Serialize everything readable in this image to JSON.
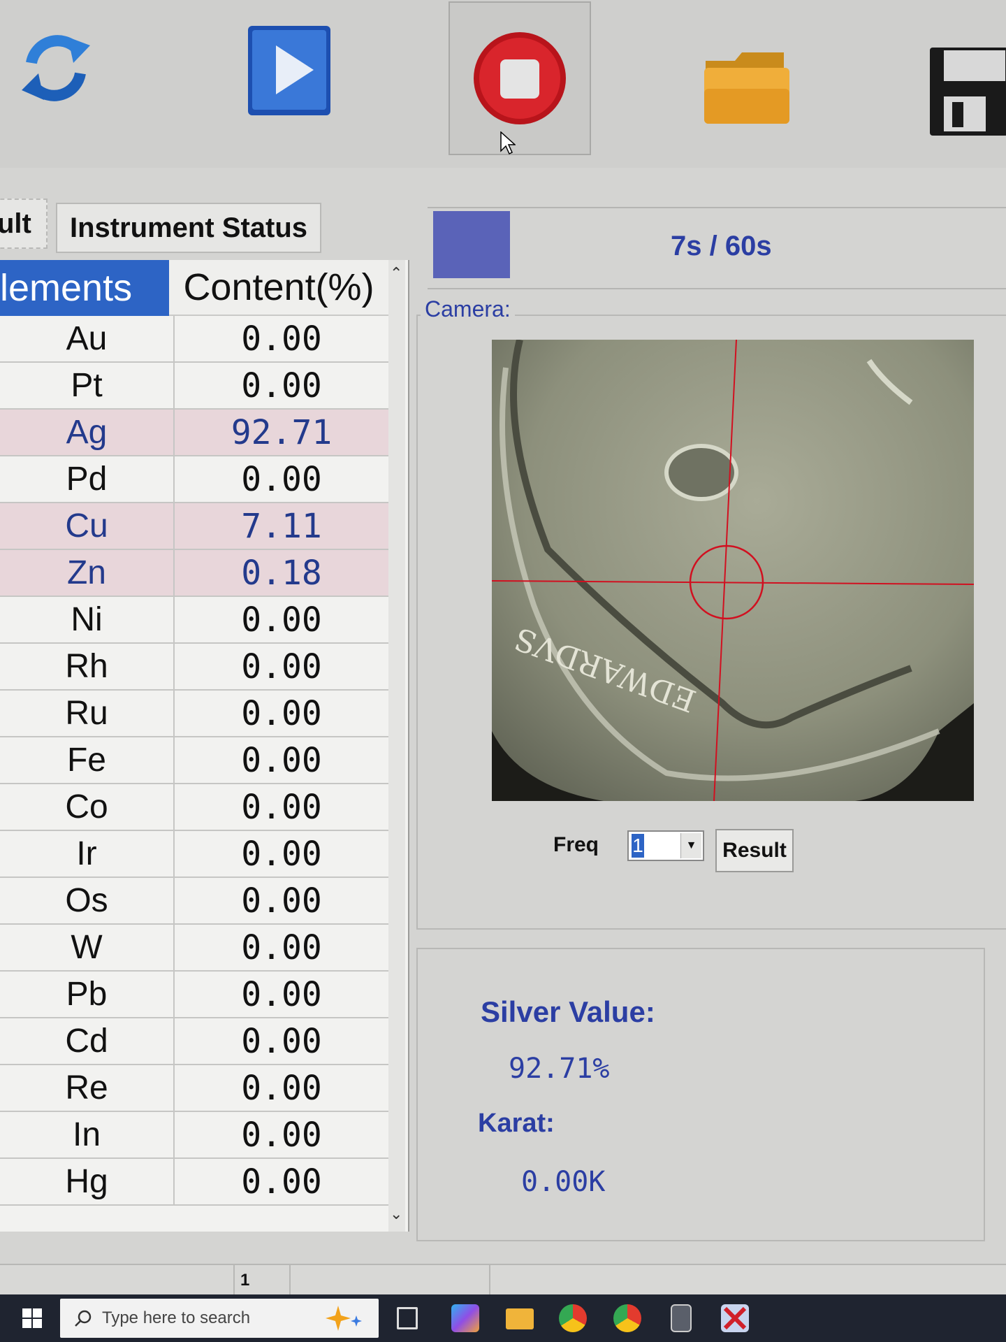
{
  "toolbar": {
    "buttons": [
      "refresh-icon",
      "play-icon",
      "stop-icon",
      "folder-icon",
      "save-icon"
    ]
  },
  "tabs": {
    "result": "ult",
    "status": "Instrument Status"
  },
  "table": {
    "headers": {
      "elements": "lements",
      "content": "Content(%)"
    },
    "rows": [
      {
        "el": "Au",
        "val": "0.00"
      },
      {
        "el": "Pt",
        "val": "0.00"
      },
      {
        "el": "Ag",
        "val": "92.71"
      },
      {
        "el": "Pd",
        "val": "0.00"
      },
      {
        "el": "Cu",
        "val": "7.11"
      },
      {
        "el": "Zn",
        "val": "0.18"
      },
      {
        "el": "Ni",
        "val": "0.00"
      },
      {
        "el": "Rh",
        "val": "0.00"
      },
      {
        "el": "Ru",
        "val": "0.00"
      },
      {
        "el": "Fe",
        "val": "0.00"
      },
      {
        "el": "Co",
        "val": "0.00"
      },
      {
        "el": "Ir",
        "val": "0.00"
      },
      {
        "el": "Os",
        "val": "0.00"
      },
      {
        "el": "W",
        "val": "0.00"
      },
      {
        "el": "Pb",
        "val": "0.00"
      },
      {
        "el": "Cd",
        "val": "0.00"
      },
      {
        "el": "Re",
        "val": "0.00"
      },
      {
        "el": "In",
        "val": "0.00"
      },
      {
        "el": "Hg",
        "val": "0.00"
      }
    ],
    "highlight_color": "#e8d6da"
  },
  "progress": {
    "text": "7s / 60s",
    "elapsed": 7,
    "total": 60
  },
  "camera": {
    "label": "Camera:",
    "coin_text": "EDWARDVS"
  },
  "controls": {
    "freq_label": "Freq",
    "freq_value": "1",
    "result_button": "Result"
  },
  "value_panel": {
    "silver_label": "Silver Value:",
    "silver_value": "92.71%",
    "karat_label": "Karat:",
    "karat_value": "0.00K"
  },
  "statusbar": {
    "cell1": "1"
  },
  "taskbar": {
    "search_placeholder": "Type here to search"
  },
  "colors": {
    "accent": "#2d64c5",
    "label_blue": "#2b3ea3",
    "stop_red": "#d01c24"
  }
}
